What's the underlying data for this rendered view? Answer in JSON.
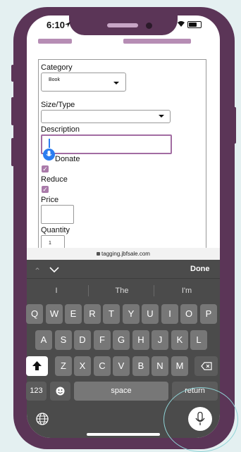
{
  "status_bar": {
    "time": "6:10"
  },
  "form": {
    "category": {
      "label": "Category",
      "value": "Book"
    },
    "size_type": {
      "label": "Size/Type",
      "value": ""
    },
    "description": {
      "label": "Description",
      "value": ""
    },
    "donate": {
      "label": "Donate",
      "checked": true
    },
    "reduce": {
      "label": "Reduce",
      "checked": true
    },
    "price": {
      "label": "Price",
      "value": ""
    },
    "quantity": {
      "label": "Quantity",
      "value": "1"
    }
  },
  "url_bar": {
    "url": "tagging.jbfsale.com"
  },
  "keyboard": {
    "done_label": "Done",
    "suggestions": [
      "I",
      "The",
      "I'm"
    ],
    "row1": [
      "Q",
      "W",
      "E",
      "R",
      "T",
      "Y",
      "U",
      "I",
      "O",
      "P"
    ],
    "row2": [
      "A",
      "S",
      "D",
      "F",
      "G",
      "H",
      "J",
      "K",
      "L"
    ],
    "row3": [
      "Z",
      "X",
      "C",
      "V",
      "B",
      "N",
      "M"
    ],
    "numbers_label": "123",
    "space_label": "space",
    "return_label": "return"
  }
}
